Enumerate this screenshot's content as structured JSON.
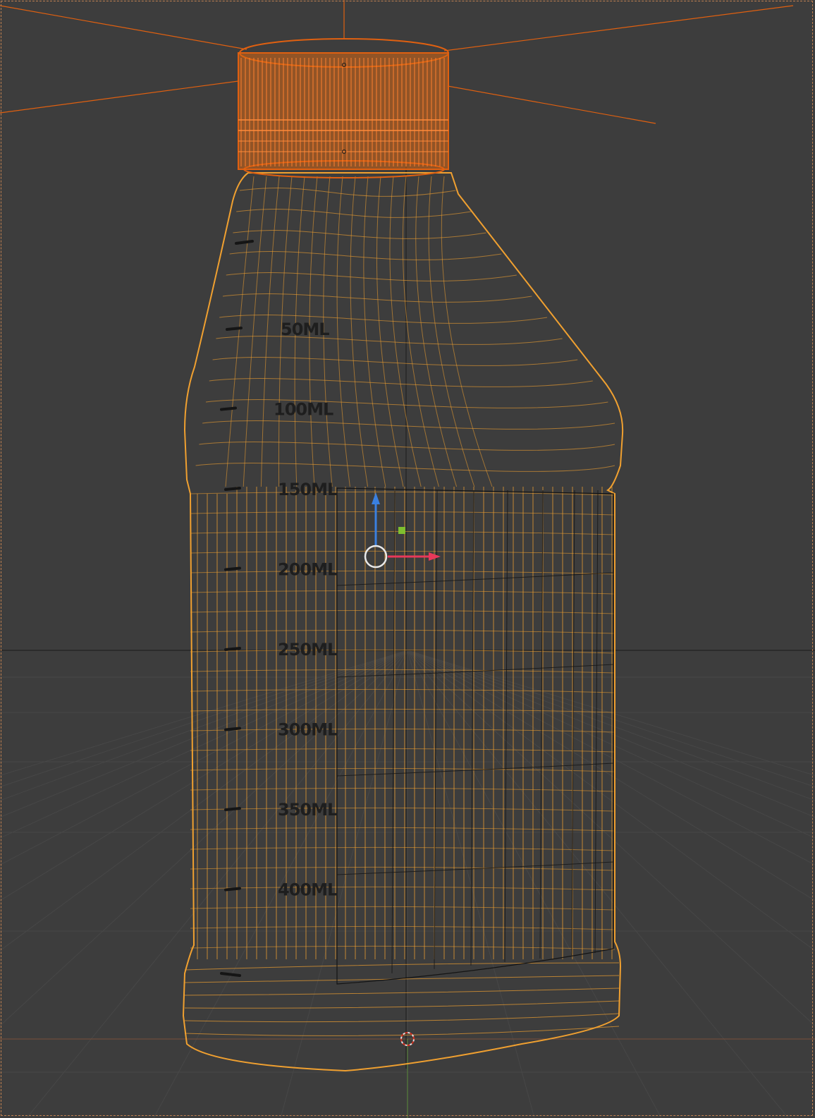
{
  "viewport": {
    "mode": "wireframe",
    "colors": {
      "background": "#3d3d3d",
      "mesh_active": "#f0a030",
      "mesh_selected": "#e06010",
      "dark_mesh": "#141414",
      "gizmo_x": "#e8385a",
      "gizmo_z": "#3a80e0",
      "gizmo_center": "#7fbf2f",
      "grid_line": "#4a4a4a",
      "axis_x": "#7a4f3a",
      "axis_y": "#5a8a3a"
    }
  },
  "bottle": {
    "cap_icon": "bottle-cap-icon",
    "graduations": [
      {
        "label": "50ML"
      },
      {
        "label": "100ML"
      },
      {
        "label": "150ML"
      },
      {
        "label": "200ML"
      },
      {
        "label": "250ML"
      },
      {
        "label": "300ML"
      },
      {
        "label": "350ML"
      },
      {
        "label": "400ML"
      }
    ]
  },
  "gizmo": {
    "icons": [
      "move-gizmo-center-icon",
      "x-axis-arrow-icon",
      "z-axis-arrow-icon",
      "plane-handle-icon"
    ]
  },
  "cursor_3d": {
    "icon": "3d-cursor-icon"
  }
}
